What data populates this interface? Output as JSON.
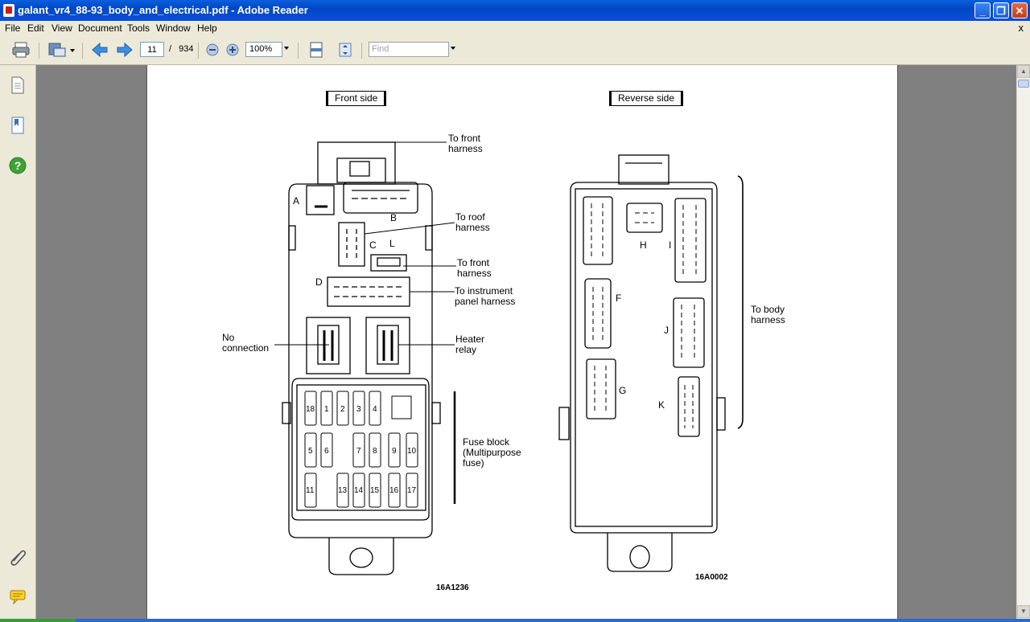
{
  "window": {
    "title": "galant_vr4_88-93_body_and_electrical.pdf - Adobe Reader",
    "minimize": "_",
    "maximize": "❐",
    "close": "✕"
  },
  "menu": {
    "items": [
      {
        "label": "File"
      },
      {
        "label": "Edit"
      },
      {
        "label": "View"
      },
      {
        "label": "Document"
      },
      {
        "label": "Tools"
      },
      {
        "label": "Window"
      },
      {
        "label": "Help"
      }
    ],
    "close_doc": "x"
  },
  "toolbar": {
    "page_current": "11",
    "page_separator": "/",
    "page_total": "934",
    "zoom": "100%",
    "find_placeholder": "Find"
  },
  "diagram": {
    "front_title": "Front side",
    "reverse_title": "Reverse side",
    "front_labels": {
      "to_front_harness_1": [
        "To front",
        "harness"
      ],
      "to_roof_harness": [
        "To roof",
        "harness"
      ],
      "to_front_harness_2": [
        "To front",
        "harness"
      ],
      "to_instrument": [
        "To instrument",
        "panel harness"
      ],
      "no_connection": [
        "No",
        "connection"
      ],
      "heater_relay": [
        "Heater",
        "relay"
      ],
      "fuse_block": [
        "Fuse block",
        "(Multipurpose",
        "fuse)"
      ],
      "connector_letters": [
        "A",
        "B",
        "C",
        "L",
        "D"
      ],
      "fuse_numbers": [
        "18",
        "1",
        "2",
        "3",
        "4",
        "5",
        "6",
        "7",
        "8",
        "9",
        "10",
        "11",
        "13",
        "14",
        "15",
        "16",
        "17"
      ]
    },
    "reverse_labels": {
      "to_body_harness": [
        "To body",
        "harness"
      ],
      "connector_letters": [
        "H",
        "I",
        "F",
        "J",
        "G",
        "K"
      ]
    },
    "front_code": "16A1236",
    "reverse_code": "16A0002"
  }
}
